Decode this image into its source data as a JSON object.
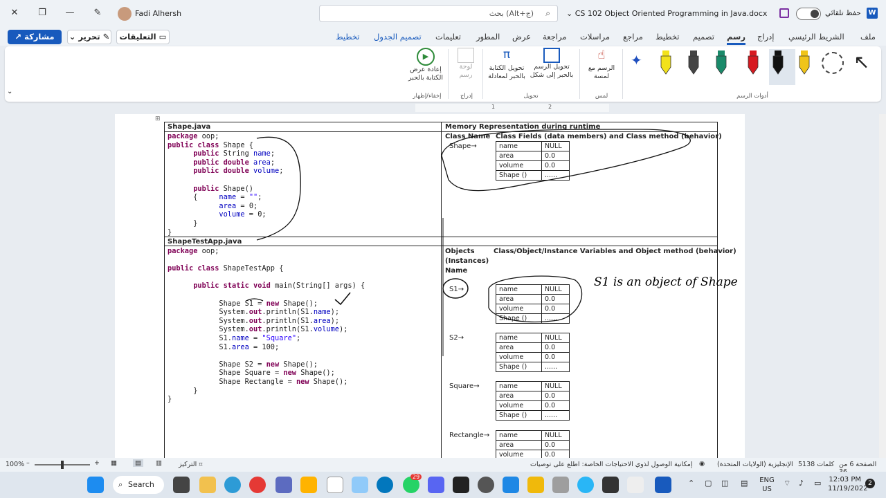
{
  "titlebar": {
    "user_name": "Fadi Alhersh",
    "search_placeholder": "بحث (Alt+ج)",
    "doc_title": "CS 102 Object Oriented Programming in Java.docx",
    "autosave_label": "حفظ تلقائي",
    "app_letter": "W"
  },
  "tabs": [
    "ملف",
    "الشريط الرئيسي",
    "إدراج",
    "رسم",
    "تصميم",
    "تخطيط",
    "مراجع",
    "مراسلات",
    "مراجعة",
    "عرض",
    "المطور",
    "تعليمات",
    "تصميم الجدول",
    "تخطيط"
  ],
  "actions": {
    "share": "مشاركة",
    "edit": "تحرير",
    "comments": "التعليقات"
  },
  "ribbon": {
    "replay": "إعادة عرض الكتابة بالحبر",
    "canvas": "لوحة رسم",
    "ink_to_math": "تحويل الكتابة بالحبر لمعادلة",
    "ink_to_shape": "تحويل الرسم بالحبر إلى شكل",
    "draw_touch": "الرسم مع لمسة",
    "groups": {
      "replay": "إخفاء/إظهار",
      "insert": "إدراج",
      "convert": "تحويل",
      "touch": "لمس",
      "tools": "أدوات الرسم"
    },
    "pen_colors": [
      "#1f4fbf",
      "#f2e21b",
      "#444444",
      "#1a8a6a",
      "#d71920",
      "#111111",
      "#f0c419"
    ]
  },
  "ruler": {
    "marks": [
      "1",
      "2"
    ]
  },
  "document": {
    "file1": "Shape.java",
    "file2": "ShapeTestApp.java",
    "mem_header": "Memory Representation during runtime",
    "class_name_header": "Class Name",
    "class_fields_header": "Class Fields (data members) and Class method (behavior)",
    "class_name": "Shape",
    "objects_header": "Objects (Instances) Name",
    "instance_header": "Class/Object/Instance Variables and Object method (behavior)",
    "fields": [
      {
        "name": "name",
        "value": "NULL"
      },
      {
        "name": "area",
        "value": "0.0"
      },
      {
        "name": "volume",
        "value": "0.0"
      },
      {
        "name": "Shape ()",
        "value": "......"
      }
    ],
    "objects": [
      "S1",
      "S2",
      "Square",
      "Rectangle"
    ],
    "handwritten_note": "S1 is an object of Shape"
  },
  "status": {
    "page": "الصفحة 6 من 36",
    "words": "5138 كلمات",
    "language": "الإنجليزية (الولايات المتحدة)",
    "accessibility": "إمكانية الوصول لذوي الاحتياجات الخاصة: اطلع على توصيات",
    "focus": "التركيز",
    "zoom": "100%"
  },
  "taskbar": {
    "search": "Search",
    "badge_whatsapp": "29",
    "lang": "ENG",
    "region": "US",
    "time": "12:03 PM",
    "date": "11/19/2022",
    "notif": "2"
  }
}
